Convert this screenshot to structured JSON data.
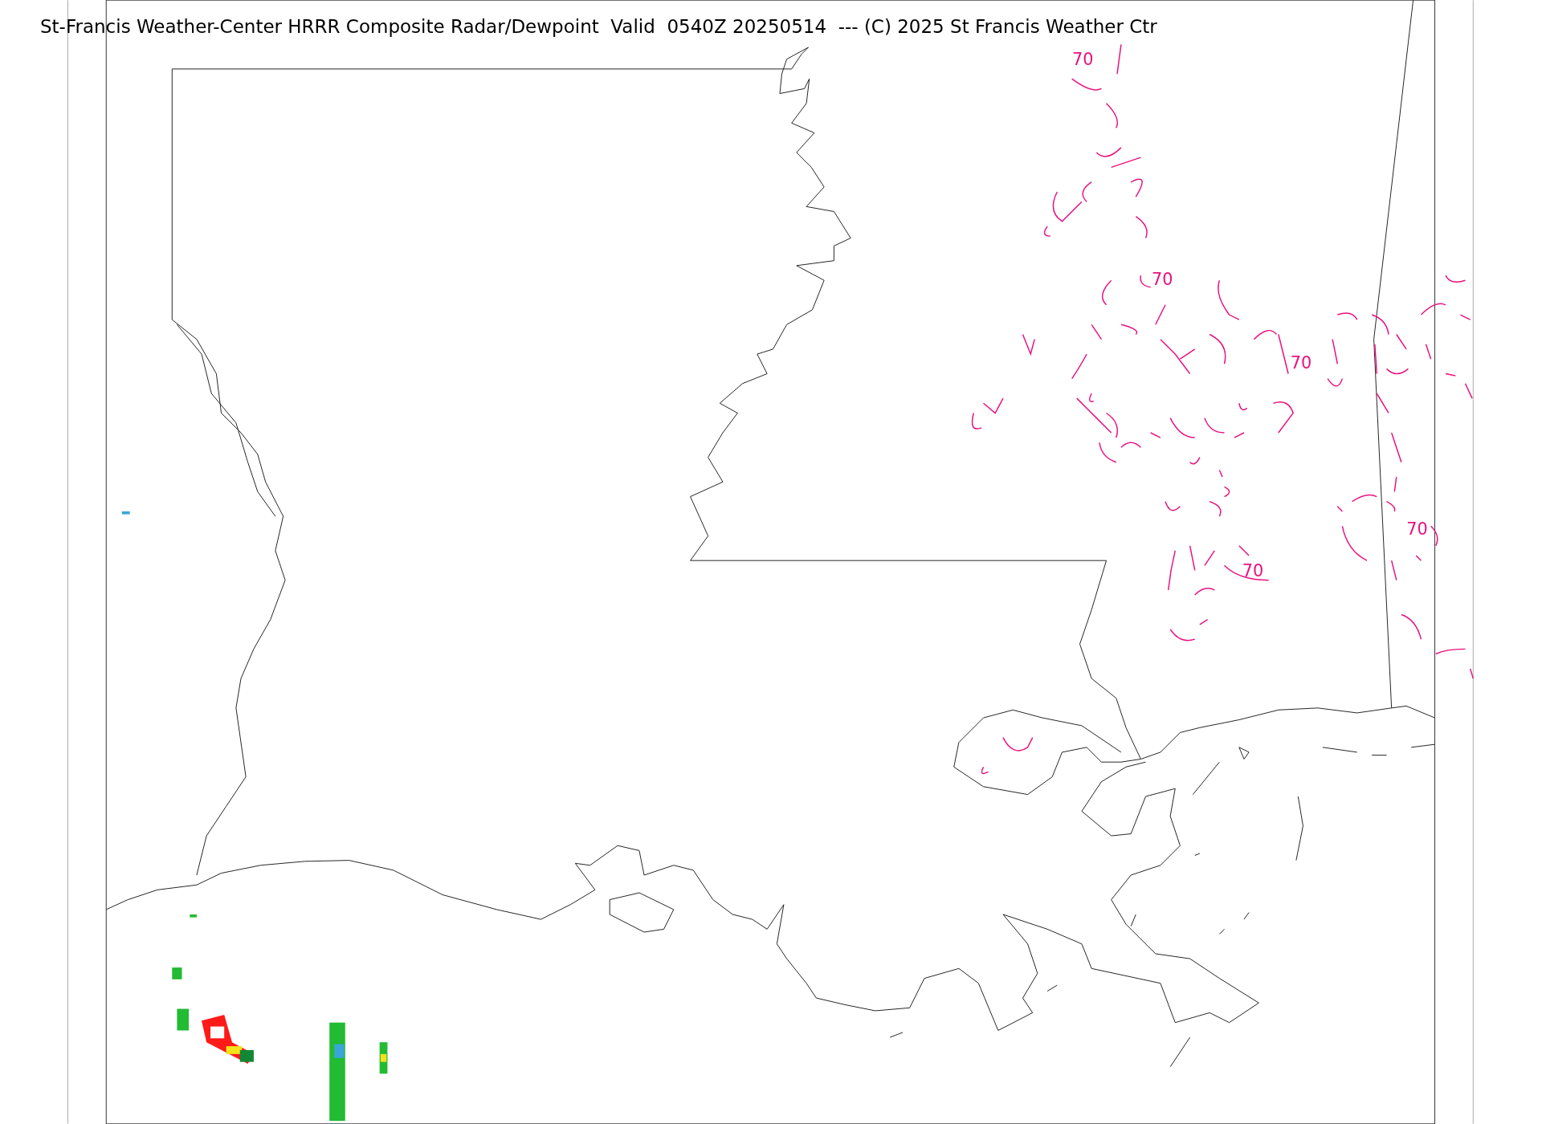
{
  "title": "St-Francis Weather-Center HRRR Composite Radar/Dewpoint  Valid  0540Z 20250514  --- (C) 2025 St Francis Weather Ctr",
  "contour_labels": [
    {
      "text": "70"
    },
    {
      "text": "70"
    },
    {
      "text": "70"
    },
    {
      "text": "70"
    },
    {
      "text": "70"
    }
  ]
}
